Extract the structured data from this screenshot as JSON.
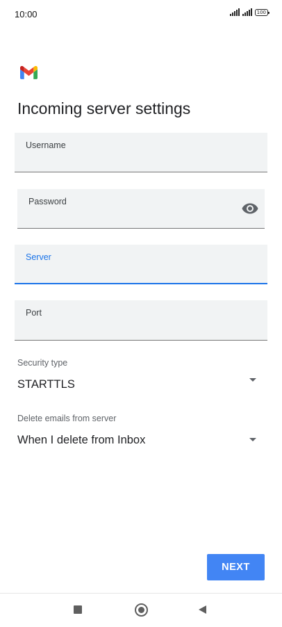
{
  "status_bar": {
    "time": "10:00",
    "battery": "100",
    "icons": [
      "signal-icon",
      "signal-icon",
      "battery-icon"
    ]
  },
  "app": {
    "logo": "gmail-logo",
    "brand_colors": [
      "#4285f4",
      "#ea4335",
      "#fbbc04",
      "#34a853",
      "#c5221f"
    ]
  },
  "page": {
    "title": "Incoming server settings"
  },
  "form": {
    "username": {
      "label": "Username",
      "value": ""
    },
    "password": {
      "label": "Password",
      "value": "",
      "visibility_icon": "eye-icon"
    },
    "server": {
      "label": "Server",
      "value": "",
      "focused": true
    },
    "port": {
      "label": "Port",
      "value": ""
    },
    "security_type": {
      "label": "Security type",
      "value": "STARTTLS",
      "icon": "dropdown-arrow-icon"
    },
    "delete_emails": {
      "label": "Delete emails from server",
      "value": "When I delete from Inbox",
      "icon": "dropdown-arrow-icon"
    }
  },
  "actions": {
    "next_label": "NEXT",
    "accent_color": "#4285f4",
    "focus_color": "#1a73e8"
  },
  "nav_bar": {
    "icons": [
      "recent-apps-icon",
      "home-icon",
      "back-icon"
    ]
  }
}
